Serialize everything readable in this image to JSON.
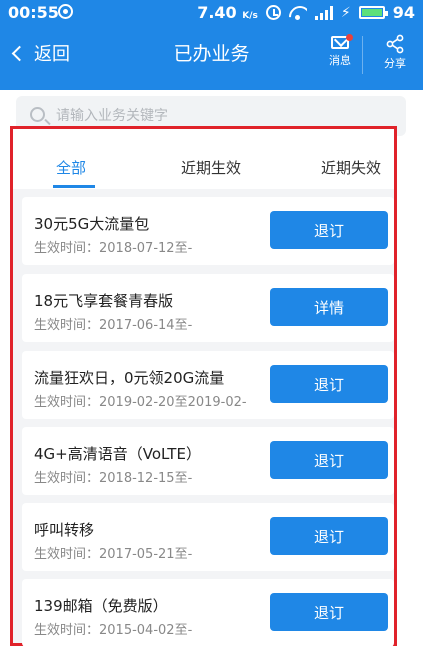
{
  "status_bar": {
    "time": "00:55",
    "speed": "7.40",
    "speed_unit": "K/s",
    "battery": "94"
  },
  "nav": {
    "back_label": "返回",
    "title": "已办业务",
    "message_label": "消息",
    "share_label": "分享"
  },
  "search": {
    "placeholder": "请输入业务关键字"
  },
  "tabs": [
    {
      "label": "全部",
      "active": true
    },
    {
      "label": "近期生效",
      "active": false
    },
    {
      "label": "近期失效",
      "active": false
    }
  ],
  "date_prefix": "生效时间：",
  "services": [
    {
      "name": "30元5G大流量包",
      "date": "2018-07-12至-",
      "action": "退订"
    },
    {
      "name": "18元飞享套餐青春版",
      "date": "2017-06-14至-",
      "action": "详情"
    },
    {
      "name": "流量狂欢日，0元领20G流量",
      "date": "2019-02-20至2019-02-",
      "action": "退订"
    },
    {
      "name": "4G+高清语音（VoLTE）",
      "date": "2018-12-15至-",
      "action": "退订"
    },
    {
      "name": "呼叫转移",
      "date": "2017-05-21至-",
      "action": "退订"
    },
    {
      "name": "139邮箱（免费版）",
      "date": "2015-04-02至-",
      "action": "退订"
    }
  ],
  "colors": {
    "brand": "#1f87e6",
    "highlight_border": "#e0222a",
    "unread_dot": "#e8413c"
  }
}
